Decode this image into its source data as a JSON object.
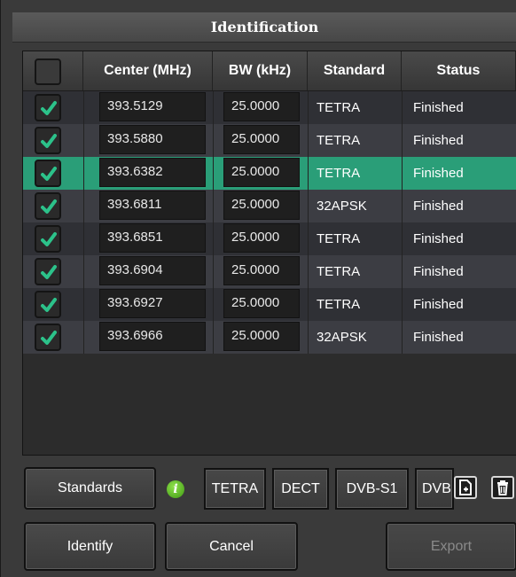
{
  "window": {
    "title": "Identification"
  },
  "table": {
    "headers": {
      "center": "Center (MHz)",
      "bw": "BW (kHz)",
      "standard": "Standard",
      "status": "Status"
    },
    "rows": [
      {
        "checked": true,
        "center": "393.5129",
        "bw": "25.0000",
        "standard": "TETRA",
        "status": "Finished",
        "selected": false
      },
      {
        "checked": true,
        "center": "393.5880",
        "bw": "25.0000",
        "standard": "TETRA",
        "status": "Finished",
        "selected": false
      },
      {
        "checked": true,
        "center": "393.6382",
        "bw": "25.0000",
        "standard": "TETRA",
        "status": "Finished",
        "selected": true
      },
      {
        "checked": true,
        "center": "393.6811",
        "bw": "25.0000",
        "standard": "32APSK",
        "status": "Finished",
        "selected": false
      },
      {
        "checked": true,
        "center": "393.6851",
        "bw": "25.0000",
        "standard": "TETRA",
        "status": "Finished",
        "selected": false
      },
      {
        "checked": true,
        "center": "393.6904",
        "bw": "25.0000",
        "standard": "TETRA",
        "status": "Finished",
        "selected": false
      },
      {
        "checked": true,
        "center": "393.6927",
        "bw": "25.0000",
        "standard": "TETRA",
        "status": "Finished",
        "selected": false
      },
      {
        "checked": true,
        "center": "393.6966",
        "bw": "25.0000",
        "standard": "32APSK",
        "status": "Finished",
        "selected": false
      }
    ]
  },
  "toolbar": {
    "standards_label": "Standards",
    "info_icon": "info-icon",
    "chips": [
      "TETRA",
      "DECT",
      "DVB-S1",
      "DVB"
    ],
    "export_icon": "export-file-icon",
    "trash_icon": "trash-icon"
  },
  "actions": {
    "identify_label": "Identify",
    "cancel_label": "Cancel",
    "export_label": "Export"
  },
  "colors": {
    "selected_row": "#2a9e78",
    "check_green": "#2cc28a",
    "info_green": "#5fbf24"
  }
}
